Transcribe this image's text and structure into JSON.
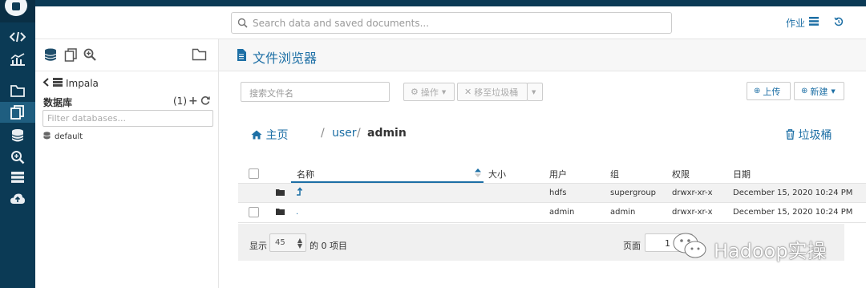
{
  "header": {
    "search_placeholder": "Search data and saved documents...",
    "jobs_label": "作业"
  },
  "rail": {
    "icons": [
      "hue-logo",
      "editor-icon",
      "dashboard-icon",
      "documents-icon",
      "files-icon",
      "tables-icon",
      "search-index-icon",
      "jobs-icon",
      "importer-icon"
    ]
  },
  "assist": {
    "back_label": "Impala",
    "db_title": "数据库",
    "db_count": "(1)",
    "filter_placeholder": "Filter databases...",
    "databases": [
      "default"
    ]
  },
  "main": {
    "title": "文件浏览器",
    "file_search_placeholder": "搜索文件名",
    "actions_label": "操作",
    "move_to_trash_label": "移至垃圾桶",
    "upload_label": "上传",
    "new_label": "新建",
    "breadcrumb": {
      "home": "主页",
      "sep1": "/",
      "part1": "user",
      "sep2": "/",
      "part2": "admin"
    },
    "trash_label": "垃圾桶"
  },
  "table": {
    "headers": {
      "name": "名称",
      "size": "大小",
      "user": "用户",
      "group": "组",
      "permission": "权限",
      "date": "日期"
    },
    "rows": [
      {
        "name": "",
        "size": "",
        "user": "hdfs",
        "group": "supergroup",
        "permission": "drwxr-xr-x",
        "date": "December 15, 2020 10:24 PM"
      },
      {
        "name": ".",
        "size": "",
        "user": "admin",
        "group": "admin",
        "permission": "drwxr-xr-x",
        "date": "December 15, 2020 10:24 PM"
      }
    ]
  },
  "footer": {
    "show_label": "显示",
    "page_size": "45",
    "items_label": "的 0 项目",
    "page_label": "页面",
    "page_value": "1"
  },
  "watermark": {
    "text": "Hadoop实操"
  },
  "colors": {
    "rail": "#0b3a55",
    "accent": "#1d6fa5",
    "row_highlight": "#f2f2f2"
  }
}
